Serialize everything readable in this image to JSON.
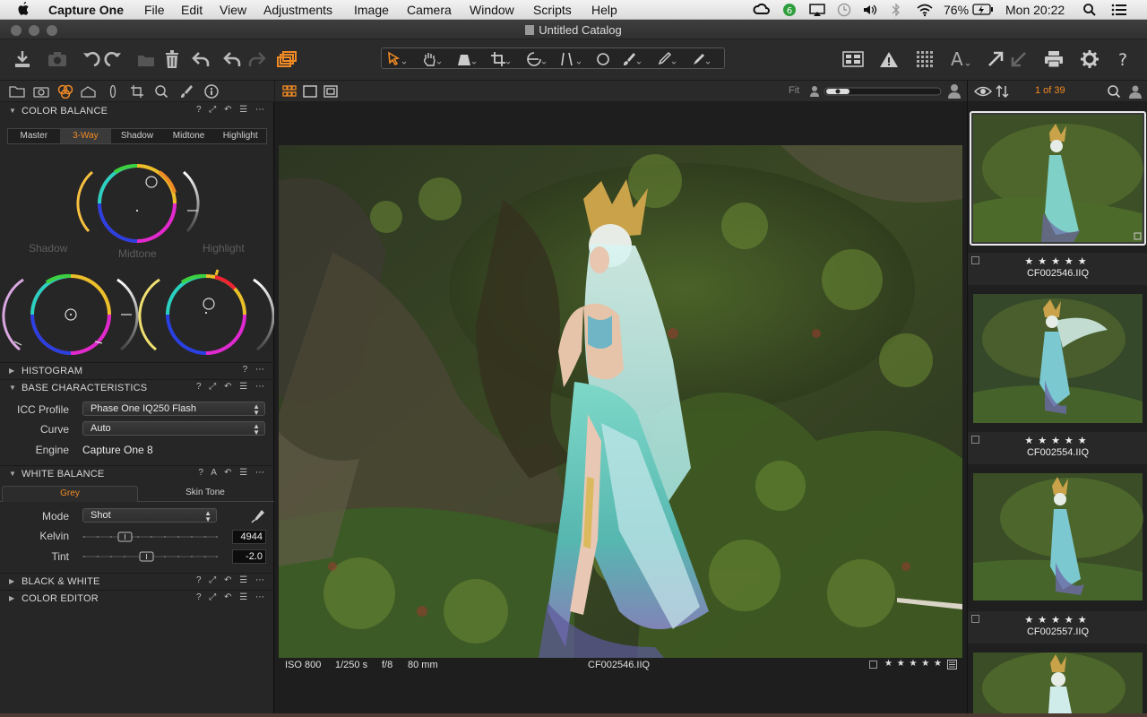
{
  "menubar": {
    "app_name": "Capture One",
    "items": [
      "File",
      "Edit",
      "View",
      "Adjustments",
      "Image",
      "Camera",
      "Window",
      "Scripts",
      "Help"
    ],
    "battery": "76%",
    "clock": "Mon 20:22"
  },
  "window": {
    "title": "Untitled Catalog"
  },
  "colors": {
    "accent": "#f08a24",
    "panel": "#262626",
    "toolbar": "#2b2b2b"
  },
  "color_balance": {
    "header": "COLOR BALANCE",
    "tabs": [
      "Master",
      "3-Way",
      "Shadow",
      "Midtone",
      "Highlight"
    ],
    "selected_tab": "3-Way",
    "wheel_labels": {
      "shadow": "Shadow",
      "midtone": "Midtone",
      "highlight": "Highlight"
    }
  },
  "histogram": {
    "header": "HISTOGRAM"
  },
  "base": {
    "header": "BASE CHARACTERISTICS",
    "icc_label": "ICC Profile",
    "icc_value": "Phase One IQ250 Flash",
    "curve_label": "Curve",
    "curve_value": "Auto",
    "engine_label": "Engine",
    "engine_value": "Capture One 8"
  },
  "white_balance": {
    "header": "WHITE BALANCE",
    "tabs": [
      "Grey",
      "Skin Tone"
    ],
    "selected_tab": "Grey",
    "mode_label": "Mode",
    "mode_value": "Shot",
    "kelvin_label": "Kelvin",
    "kelvin_value": "4944",
    "tint_label": "Tint",
    "tint_value": "-2.0"
  },
  "bw": {
    "header": "BLACK & WHITE"
  },
  "color_editor": {
    "header": "COLOR EDITOR"
  },
  "viewer": {
    "zoom_label": "Fit",
    "iso": "ISO 800",
    "shutter": "1/250 s",
    "aperture": "f/8",
    "focal": "80 mm",
    "filename": "CF002546.IIQ",
    "stars": "★ ★ ★ ★ ★"
  },
  "browser": {
    "counter": "1 of 39",
    "thumbs": [
      {
        "name": "CF002546.IIQ",
        "stars": "★★★★★"
      },
      {
        "name": "CF002554.IIQ",
        "stars": "★★★★★"
      },
      {
        "name": "CF002557.IIQ",
        "stars": "★★★★★"
      }
    ]
  },
  "icons": [
    "apple-icon",
    "import-icon",
    "camera-icon",
    "rotate-left-icon",
    "rotate-right-icon",
    "move-icon",
    "trash-icon",
    "undo-icon",
    "redo-icon",
    "variants-icon",
    "cursor-tool-icon",
    "hand-tool-icon",
    "keystone-icon",
    "crop-icon",
    "straighten-icon",
    "grid-line-icon",
    "spot-icon",
    "brush-icon",
    "picker-icon",
    "eraser-icon",
    "grid-view-icon",
    "warning-icon",
    "focus-icon",
    "text-icon",
    "export-icon",
    "print-icon",
    "gear-icon",
    "help-icon"
  ]
}
